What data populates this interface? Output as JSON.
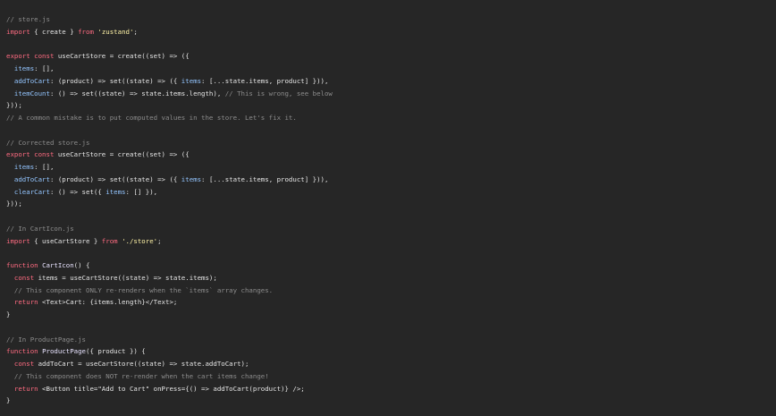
{
  "editor": {
    "theme": {
      "background": "#262626",
      "keyword": "#ff6b81",
      "string": "#fff3a6",
      "comment": "#8c8c8c",
      "property": "#93c5ff",
      "text": "#e6e6e6"
    },
    "lines": [
      [
        {
          "t": "// store.js",
          "c": "cmt"
        }
      ],
      [
        {
          "t": "import",
          "c": "kw"
        },
        {
          "t": " { create } ",
          "c": "tx"
        },
        {
          "t": "from",
          "c": "kw"
        },
        {
          "t": " ",
          "c": "tx"
        },
        {
          "t": "'zustand'",
          "c": "str"
        },
        {
          "t": ";",
          "c": "tx"
        }
      ],
      [],
      [
        {
          "t": "export",
          "c": "kw"
        },
        {
          "t": " ",
          "c": "tx"
        },
        {
          "t": "const",
          "c": "kw"
        },
        {
          "t": " useCartStore = create((set) => ({",
          "c": "tx"
        }
      ],
      [
        {
          "t": "  ",
          "c": "tx"
        },
        {
          "t": "items",
          "c": "prop"
        },
        {
          "t": ": [],",
          "c": "tx"
        }
      ],
      [
        {
          "t": "  ",
          "c": "tx"
        },
        {
          "t": "addToCart",
          "c": "prop"
        },
        {
          "t": ": (product) => set((state) => ({ ",
          "c": "tx"
        },
        {
          "t": "items",
          "c": "prop"
        },
        {
          "t": ": [...state.items, product] })),",
          "c": "tx"
        }
      ],
      [
        {
          "t": "  ",
          "c": "tx"
        },
        {
          "t": "itemCount",
          "c": "prop"
        },
        {
          "t": ": () => set((state) => state.items.length), ",
          "c": "tx"
        },
        {
          "t": "// This is wrong, see below",
          "c": "cmt"
        }
      ],
      [
        {
          "t": "}));",
          "c": "tx"
        }
      ],
      [
        {
          "t": "// A common mistake is to put computed values in the store. Let's fix it.",
          "c": "cmt"
        }
      ],
      [],
      [
        {
          "t": "// Corrected store.js",
          "c": "cmt"
        }
      ],
      [
        {
          "t": "export",
          "c": "kw"
        },
        {
          "t": " ",
          "c": "tx"
        },
        {
          "t": "const",
          "c": "kw"
        },
        {
          "t": " useCartStore = create((set) => ({",
          "c": "tx"
        }
      ],
      [
        {
          "t": "  ",
          "c": "tx"
        },
        {
          "t": "items",
          "c": "prop"
        },
        {
          "t": ": [],",
          "c": "tx"
        }
      ],
      [
        {
          "t": "  ",
          "c": "tx"
        },
        {
          "t": "addToCart",
          "c": "prop"
        },
        {
          "t": ": (product) => set((state) => ({ ",
          "c": "tx"
        },
        {
          "t": "items",
          "c": "prop"
        },
        {
          "t": ": [...state.items, product] })),",
          "c": "tx"
        }
      ],
      [
        {
          "t": "  ",
          "c": "tx"
        },
        {
          "t": "clearCart",
          "c": "prop"
        },
        {
          "t": ": () => set({ ",
          "c": "tx"
        },
        {
          "t": "items",
          "c": "prop"
        },
        {
          "t": ": [] }),",
          "c": "tx"
        }
      ],
      [
        {
          "t": "}));",
          "c": "tx"
        }
      ],
      [],
      [
        {
          "t": "// In CartIcon.js",
          "c": "cmt"
        }
      ],
      [
        {
          "t": "import",
          "c": "kw"
        },
        {
          "t": " { useCartStore } ",
          "c": "tx"
        },
        {
          "t": "from",
          "c": "kw"
        },
        {
          "t": " ",
          "c": "tx"
        },
        {
          "t": "'./store'",
          "c": "str"
        },
        {
          "t": ";",
          "c": "tx"
        }
      ],
      [],
      [
        {
          "t": "function",
          "c": "kw"
        },
        {
          "t": " ",
          "c": "tx"
        },
        {
          "t": "CartIcon",
          "c": "fn"
        },
        {
          "t": "() {",
          "c": "tx"
        }
      ],
      [
        {
          "t": "  ",
          "c": "tx"
        },
        {
          "t": "const",
          "c": "kw"
        },
        {
          "t": " items = useCartStore((state) => state.items);",
          "c": "tx"
        }
      ],
      [
        {
          "t": "  // This component ONLY re-renders when the `items` array changes.",
          "c": "cmt"
        }
      ],
      [
        {
          "t": "  ",
          "c": "tx"
        },
        {
          "t": "return",
          "c": "kw"
        },
        {
          "t": " <Text>Cart: {items.length}</Text>;",
          "c": "tx"
        }
      ],
      [
        {
          "t": "}",
          "c": "tx"
        }
      ],
      [],
      [
        {
          "t": "// In ProductPage.js",
          "c": "cmt"
        }
      ],
      [
        {
          "t": "function",
          "c": "kw"
        },
        {
          "t": " ",
          "c": "tx"
        },
        {
          "t": "ProductPage",
          "c": "fn"
        },
        {
          "t": "({ product }) {",
          "c": "tx"
        }
      ],
      [
        {
          "t": "  ",
          "c": "tx"
        },
        {
          "t": "const",
          "c": "kw"
        },
        {
          "t": " addToCart = useCartStore((state) => state.addToCart);",
          "c": "tx"
        }
      ],
      [
        {
          "t": "  // This component does NOT re-render when the cart items change!",
          "c": "cmt"
        }
      ],
      [
        {
          "t": "  ",
          "c": "tx"
        },
        {
          "t": "return",
          "c": "kw"
        },
        {
          "t": " <Button title=\"Add to Cart\" onPress={() => addToCart(product)} />;",
          "c": "tx"
        }
      ],
      [
        {
          "t": "}",
          "c": "tx"
        }
      ]
    ]
  }
}
